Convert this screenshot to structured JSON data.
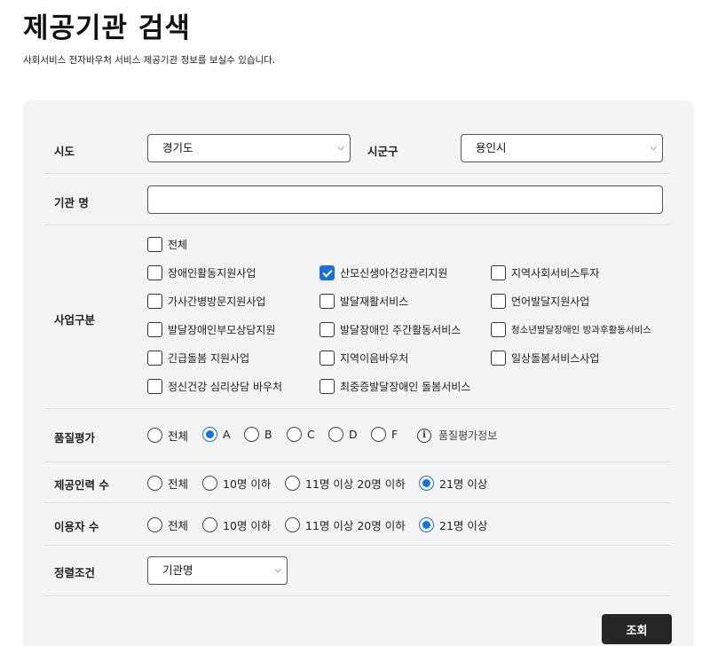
{
  "header": {
    "title": "제공기관 검색",
    "subtitle": "사회서비스 전자바우처 서비스 제공기관 정보를 보실수 있습니다."
  },
  "form": {
    "sido": {
      "label": "시도",
      "value": "경기도"
    },
    "sigungu": {
      "label": "시군구",
      "value": "용인시"
    },
    "org_name": {
      "label": "기관 명",
      "value": ""
    },
    "business": {
      "label": "사업구분",
      "options": [
        {
          "label": "전체",
          "checked": false
        },
        {
          "label": "장애인활동지원사업",
          "checked": false
        },
        {
          "label": "산모신생아건강관리지원",
          "checked": true
        },
        {
          "label": "지역사회서비스투자",
          "checked": false
        },
        {
          "label": "가사간병방문지원사업",
          "checked": false
        },
        {
          "label": "발달재활서비스",
          "checked": false
        },
        {
          "label": "언어발달지원사업",
          "checked": false
        },
        {
          "label": "발달장애인부모상담지원",
          "checked": false
        },
        {
          "label": "발달장애인 주간활동서비스",
          "checked": false
        },
        {
          "label": "청소년발달장애인 방과후활동서비스",
          "checked": false
        },
        {
          "label": "긴급돌봄 지원사업",
          "checked": false
        },
        {
          "label": "지역이음바우처",
          "checked": false
        },
        {
          "label": "일상돌봄서비스사업",
          "checked": false
        },
        {
          "label": "정신건강 심리상담 바우처",
          "checked": false
        },
        {
          "label": "최중증발달장애인 돌봄서비스",
          "checked": false
        }
      ]
    },
    "quality": {
      "label": "품질평가",
      "options": [
        "전체",
        "A",
        "B",
        "C",
        "D",
        "F"
      ],
      "selected": "A",
      "info_label": "품질평가정보",
      "info_icon": "info-icon"
    },
    "staff_count": {
      "label": "제공인력 수",
      "options": [
        "전체",
        "10명 이하",
        "11명 이상 20명 이하",
        "21명 이상"
      ],
      "selected": "21명 이상"
    },
    "user_count": {
      "label": "이용자 수",
      "options": [
        "전체",
        "10명 이하",
        "11명 이상 20명 이하",
        "21명 이상"
      ],
      "selected": "21명 이상"
    },
    "sort": {
      "label": "정렬조건",
      "value": "기관명"
    },
    "submit_label": "조회"
  },
  "colors": {
    "accent": "#1a6fe0",
    "button": "#262626",
    "panel": "#f4f4f4"
  }
}
